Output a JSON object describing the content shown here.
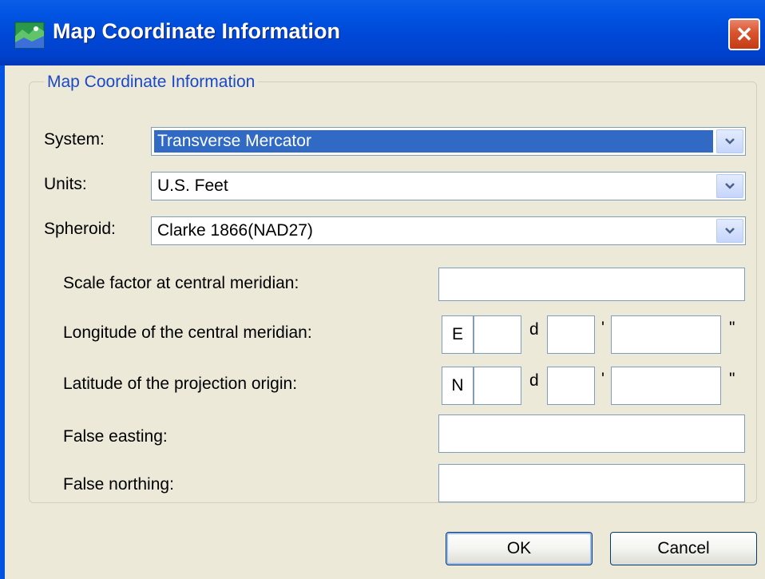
{
  "window": {
    "title": "Map Coordinate Information",
    "close_glyph": "✕"
  },
  "group": {
    "legend": "Map Coordinate Information"
  },
  "system": {
    "label": "System:",
    "value": "Transverse Mercator"
  },
  "units": {
    "label": "Units:",
    "value": "U.S. Feet"
  },
  "spheroid": {
    "label": "Spheroid:",
    "value": "Clarke 1866(NAD27)"
  },
  "scale_factor": {
    "label": "Scale factor at central meridian:",
    "value": ""
  },
  "longitude": {
    "label": "Longitude of the central meridian:",
    "hemisphere": "E",
    "degrees": "",
    "minutes": "",
    "seconds": "",
    "deg_unit": "d",
    "min_unit": "'",
    "sec_unit": "\""
  },
  "latitude": {
    "label": "Latitude of the projection origin:",
    "hemisphere": "N",
    "degrees": "",
    "minutes": "",
    "seconds": "",
    "deg_unit": "d",
    "min_unit": "'",
    "sec_unit": "\""
  },
  "false_easting": {
    "label": "False easting:",
    "value": ""
  },
  "false_northing": {
    "label": "False northing:",
    "value": ""
  },
  "buttons": {
    "ok": "OK",
    "cancel": "Cancel"
  },
  "colors": {
    "titlebar": "#0047d6",
    "selection": "#316ac5",
    "legend_text": "#1a48c8",
    "close_button": "#d9532d"
  },
  "icons": {
    "app": "map-icon",
    "dropdown": "chevron-down-icon"
  }
}
